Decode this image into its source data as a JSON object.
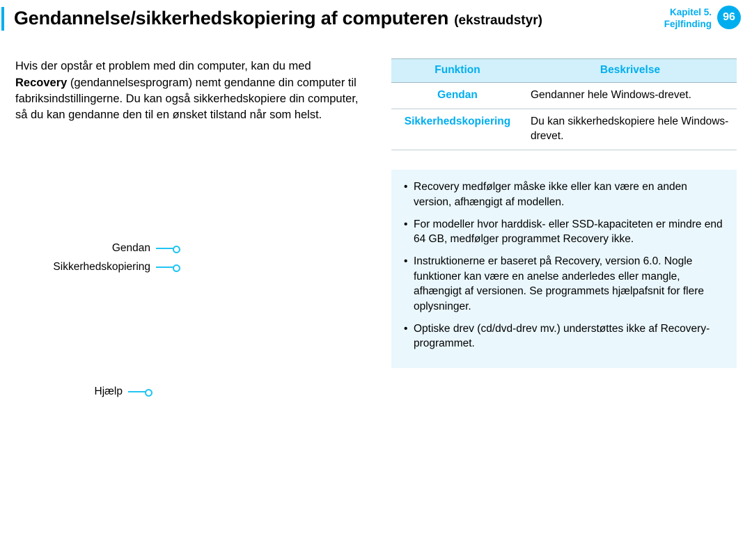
{
  "header": {
    "title_main": "Gendannelse/sikkerhedskopiering af computeren",
    "title_suffix": "(ekstraudstyr)",
    "chapter_line1": "Kapitel 5.",
    "chapter_line2": "Fejlfinding",
    "page_number": "96"
  },
  "intro": {
    "pre": "Hvis der opstår et problem med din computer, kan du med ",
    "bold": "Recovery",
    "post": " (gendannelsesprogram) nemt gendanne din computer til fabriksindstillingerne. Du kan også sikkerhedskopiere din computer, så du kan gendanne den til en ønsket tilstand når som helst."
  },
  "diagram": {
    "item1": "Gendan",
    "item2": "Sikkerhedskopiering",
    "item3": "Hjælp"
  },
  "table": {
    "h1": "Funktion",
    "h2": "Beskrivelse",
    "rows": [
      {
        "fn": "Gendan",
        "desc": "Gendanner hele Windows-drevet."
      },
      {
        "fn": "Sikkerhedskopiering",
        "desc": "Du kan sikkerhedskopiere hele Windows-drevet."
      }
    ]
  },
  "notes": [
    "Recovery medfølger måske ikke eller kan være en anden version, afhængigt af modellen.",
    "For modeller hvor harddisk- eller SSD-kapaciteten er mindre end 64 GB, medfølger programmet Recovery ikke.",
    "Instruktionerne er baseret på Recovery, version 6.0. Nogle funktioner kan være en anelse anderledes eller mangle, afhængigt af versionen. Se programmets hjælpafsnit for flere oplysninger.",
    "Optiske drev (cd/dvd-drev mv.) understøttes ikke af Recovery-programmet."
  ]
}
